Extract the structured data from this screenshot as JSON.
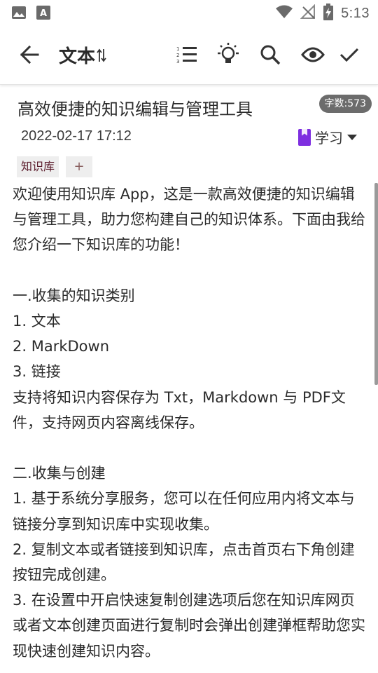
{
  "status_bar": {
    "time": "5:13"
  },
  "app_bar": {
    "title": "文本",
    "icons": [
      "back-arrow-icon",
      "sort-icon",
      "list-icon",
      "lightbulb-icon",
      "search-icon",
      "eye-icon",
      "check-icon"
    ]
  },
  "note": {
    "title": "高效便捷的知识编辑与管理工具",
    "word_count": "字数:573",
    "date": "2022-02-17 17:12",
    "category": "学习",
    "tags": [
      "知识库"
    ],
    "add_tag": "+",
    "body": "欢迎使用知识库 App，这是一款高效便捷的知识编辑与管理工具，助力您构建自己的知识体系。下面由我给您介绍一下知识库的功能！\n\n一.收集的知识类别\n1. 文本\n2. MarkDown\n3. 链接\n支持将知识内容保存为 Txt，Markdown 与 PDF文件，支持网页内容离线保存。\n\n二.收集与创建\n1. 基于系统分享服务，您可以在任何应用内将文本与链接分享到知识库中实现收集。\n2. 复制文本或者链接到知识库，点击首页右下角创建按钮完成创建。\n3. 在设置中开启快速复制创建选项后您在知识库网页或者文本创建页面进行复制时会弹出创建弹框帮助您实现快速创建知识内容。"
  },
  "colors": {
    "category_icon": "#7e2fe0",
    "badge_bg": "#6c6c6c",
    "tag_bg": "#eeeeee"
  }
}
